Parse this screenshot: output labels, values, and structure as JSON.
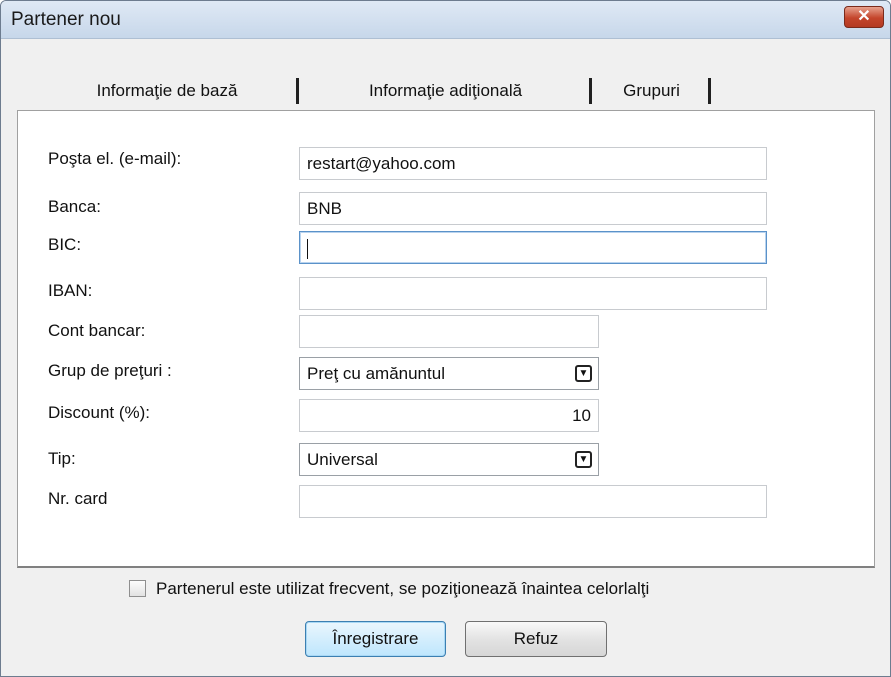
{
  "window": {
    "title": "Partener nou",
    "close_glyph": "✕"
  },
  "tabs": [
    {
      "label": "Informaţie de bază"
    },
    {
      "label": "Informaţie adiţională"
    },
    {
      "label": "Grupuri"
    }
  ],
  "form": {
    "email": {
      "label": "Poşta el. (e-mail):",
      "value": "restart@yahoo.com"
    },
    "bank": {
      "label": "Banca:",
      "value": "BNB"
    },
    "bic": {
      "label": "BIC:",
      "value": ""
    },
    "iban": {
      "label": "IBAN:",
      "value": ""
    },
    "account": {
      "label": "Cont bancar:",
      "value": ""
    },
    "price_group": {
      "label": "Grup de preţuri :",
      "value": "Preţ cu amănuntul"
    },
    "discount": {
      "label": "Discount (%):",
      "value": "10"
    },
    "type": {
      "label": "Tip:",
      "value": "Universal"
    },
    "card": {
      "label": "Nr. card",
      "value": ""
    }
  },
  "frequent_checkbox": {
    "label": "Partenerul este utilizat frecvent, se poziţionează înaintea celorlalţi",
    "checked": false
  },
  "buttons": {
    "save": "Înregistrare",
    "cancel": "Refuz"
  },
  "icons": {
    "close": "close-icon",
    "dropdown": "chevron-down-icon"
  },
  "colors": {
    "close_button": "#c4452c",
    "focus_border": "#5b92c9",
    "titlebar": "#c7d7ea"
  }
}
